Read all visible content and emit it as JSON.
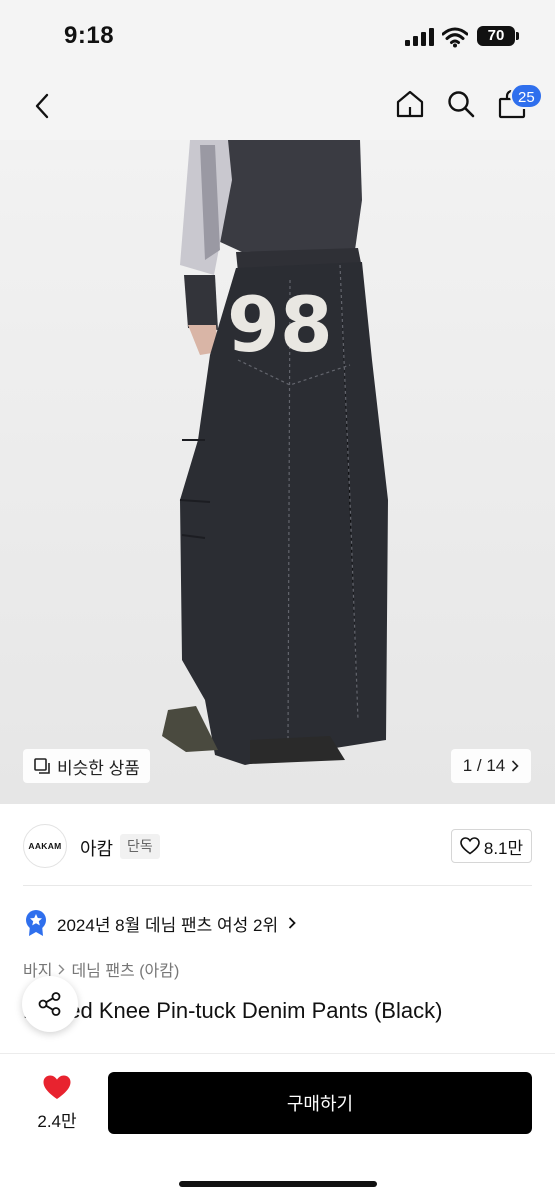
{
  "status_bar": {
    "time": "9:18",
    "battery": "70"
  },
  "nav": {
    "cart_count": "25",
    "icons": {
      "back": "chevron-left-icon",
      "home": "home-icon",
      "search": "search-icon",
      "cart": "shopping-bag-icon"
    }
  },
  "product_image": {
    "jersey_number": "98",
    "similar_label": "비슷한 상품",
    "counter": "1 / 14"
  },
  "brand": {
    "logo_text": "AAKAM",
    "name": "아캄",
    "badge": "단독",
    "likes": "8.1만"
  },
  "ranking": {
    "text": "2024년 8월 데님 팬츠 여성 2위"
  },
  "breadcrumb": {
    "level1": "바지",
    "level2": "데님 팬츠 (아캄)"
  },
  "product": {
    "title": "Printed Knee Pin-tuck Denim Pants (Black)"
  },
  "bottom_bar": {
    "wish_count": "2.4만",
    "buy_label": "구매하기"
  },
  "colors": {
    "accent_blue": "#2f6fed",
    "heart_red": "#e8232f",
    "buy_button": "#000000"
  }
}
